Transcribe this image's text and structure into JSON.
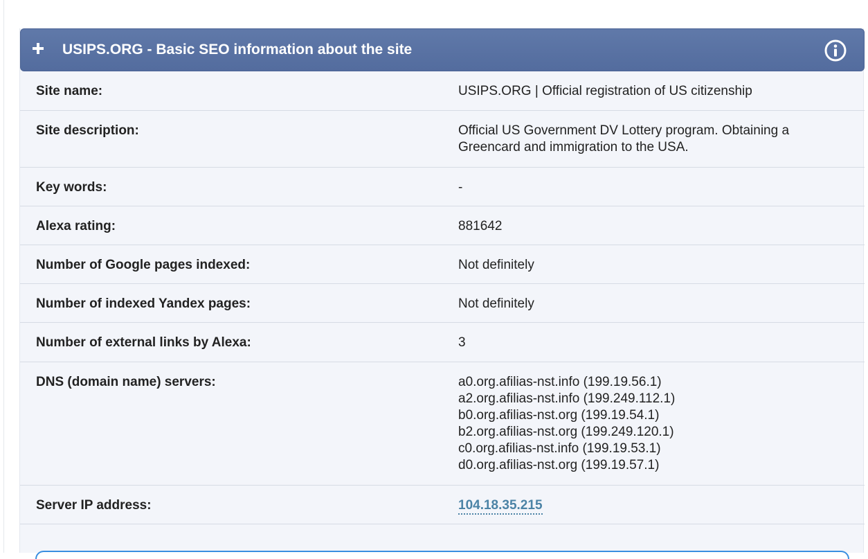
{
  "panel": {
    "title": "USIPS.ORG - Basic SEO information about the site"
  },
  "rows": [
    {
      "label": "Site name:",
      "value": [
        "USIPS.ORG | Official registration of US citizenship"
      ]
    },
    {
      "label": "Site description:",
      "value": [
        "Official US Government DV Lottery program. Obtaining a",
        "Greencard and immigration to the USA."
      ]
    },
    {
      "label": "Key words:",
      "value": [
        "-"
      ]
    },
    {
      "label": "Alexa rating:",
      "value": [
        "881642"
      ]
    },
    {
      "label": "Number of Google pages indexed:",
      "value": [
        "Not definitely"
      ]
    },
    {
      "label": "Number of indexed Yandex pages:",
      "value": [
        "Not definitely"
      ]
    },
    {
      "label": "Number of external links by Alexa:",
      "value": [
        "3"
      ]
    },
    {
      "label": "DNS (domain name) servers:",
      "value": [
        "a0.org.afilias-nst.info (199.19.56.1)",
        "a2.org.afilias-nst.info (199.249.112.1)",
        "b0.org.afilias-nst.org (199.19.54.1)",
        "b2.org.afilias-nst.org (199.249.120.1)",
        "c0.org.afilias-nst.info (199.19.53.1)",
        "d0.org.afilias-nst.org (199.19.57.1)"
      ]
    },
    {
      "label": "Server IP address:",
      "value": [
        "104.18.35.215"
      ]
    }
  ]
}
